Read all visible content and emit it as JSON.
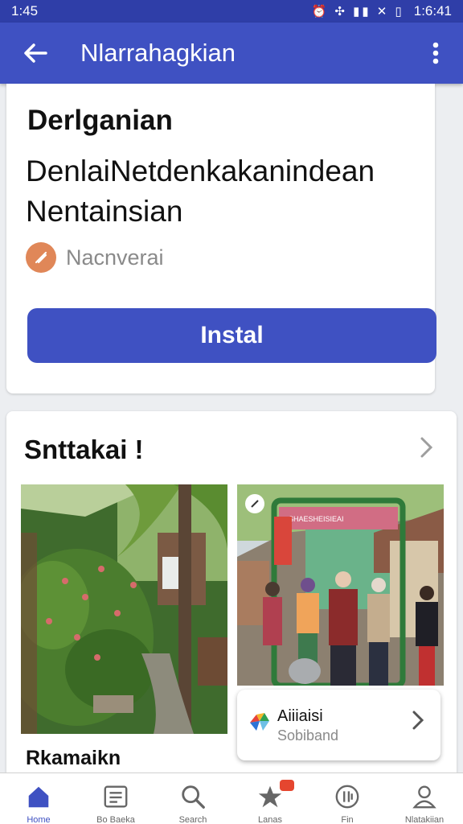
{
  "status_bar": {
    "time_left": "1:45",
    "time_right": "1:6:41"
  },
  "app_bar": {
    "title": "Nlarrahagkian"
  },
  "app_card": {
    "heading": "Derlganian",
    "description": "DenlaiNetdenkakanindean Nentainsian",
    "developer": "Nacnverai",
    "install_label": "Instal"
  },
  "screenshots": {
    "title": "Snttakai !",
    "thumbnail_label": "Rkamaikn",
    "overlay": {
      "title": "Aiiiaisi",
      "subtitle": "Sobiband"
    },
    "phone_banner_text": "SHAESHEISIEAI"
  },
  "bottom_nav": {
    "items": [
      {
        "label": "Home",
        "icon": "home-icon",
        "active": true
      },
      {
        "label": "Bo Baeka",
        "icon": "list-icon",
        "active": false
      },
      {
        "label": "Search",
        "icon": "search-icon",
        "active": false
      },
      {
        "label": "Lanas",
        "icon": "star-icon",
        "active": false
      },
      {
        "label": "Fin",
        "icon": "clock-icon",
        "active": false
      },
      {
        "label": "Nlatakiian",
        "icon": "person-icon",
        "active": false
      }
    ]
  },
  "colors": {
    "primary": "#3f51c2",
    "status": "#2f3ea8",
    "developer_icon": "#e08758"
  }
}
